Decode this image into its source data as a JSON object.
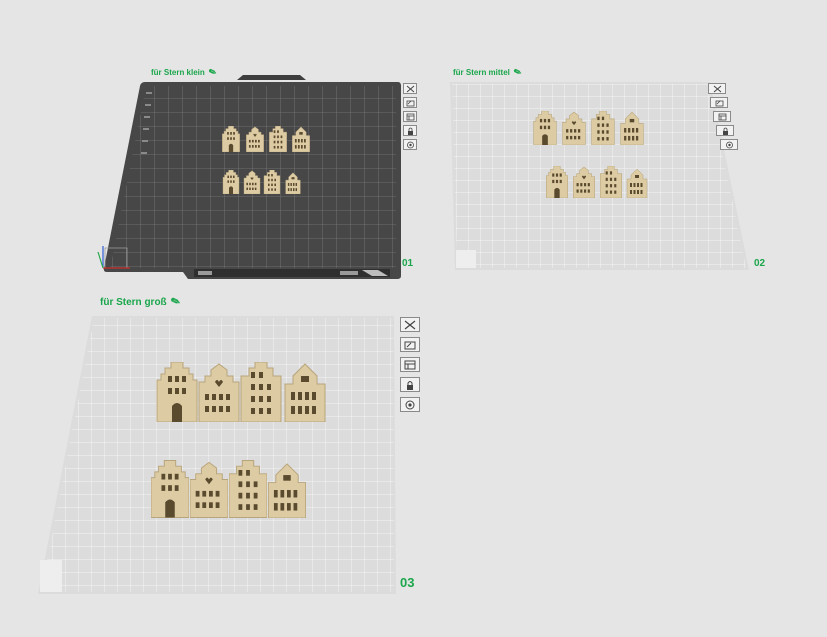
{
  "plates": [
    {
      "title": "für Stern klein",
      "number": "01"
    },
    {
      "title": "für Stern mittel",
      "number": "02"
    },
    {
      "title": "für Stern groß",
      "number": "03"
    }
  ],
  "plate_tools": [
    "close-icon",
    "auto-arrange-icon",
    "plate-settings-icon",
    "lock-icon",
    "eye-icon"
  ],
  "colors": {
    "accent": "#1aa64b",
    "active_plate": "#4a4a4a",
    "inactive_plate": "#dcdcdc",
    "model": "#dccba3"
  }
}
